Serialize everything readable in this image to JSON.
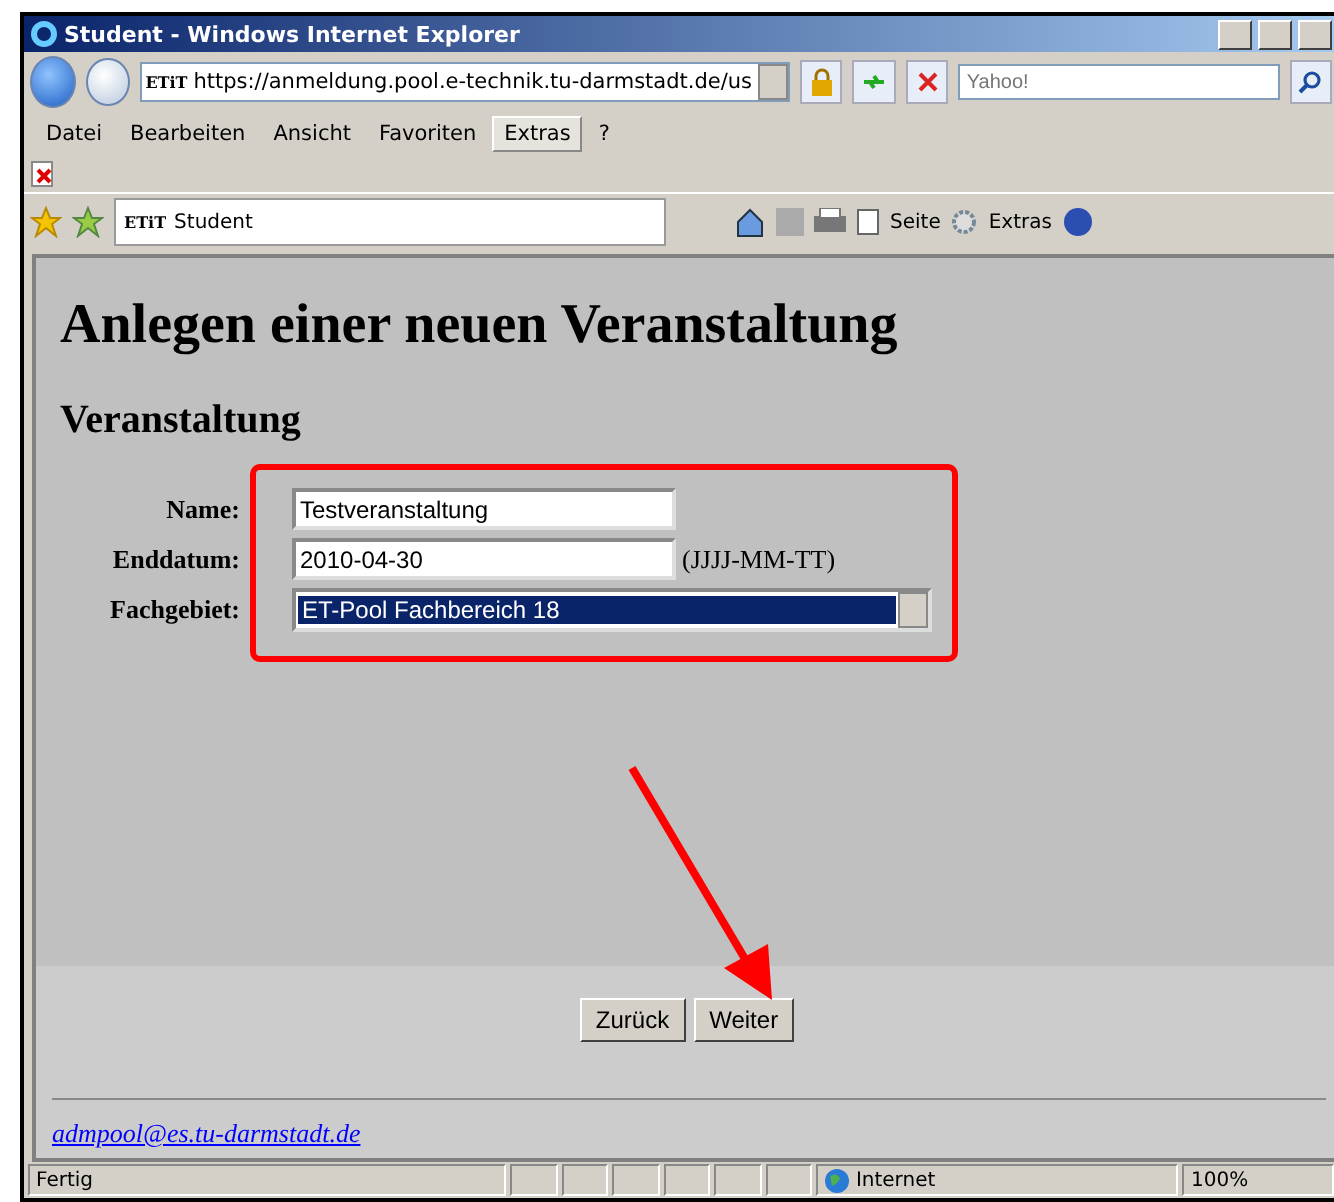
{
  "window": {
    "title": "Student - Windows Internet Explorer"
  },
  "address_bar": {
    "url": "https://anmeldung.pool.e-technik.tu-darmstadt.de/us",
    "site_badge": "ETiT"
  },
  "search": {
    "placeholder": "Yahoo!"
  },
  "menu": [
    {
      "label": "Datei",
      "selected": false
    },
    {
      "label": "Bearbeiten",
      "selected": false
    },
    {
      "label": "Ansicht",
      "selected": false
    },
    {
      "label": "Favoriten",
      "selected": false
    },
    {
      "label": "Extras",
      "selected": true
    },
    {
      "label": "?",
      "selected": false
    }
  ],
  "tab": {
    "badge": "ETiT",
    "label": "Student"
  },
  "command_bar": [
    {
      "label": "Seite"
    },
    {
      "label": "Extras"
    }
  ],
  "page": {
    "heading": "Anlegen einer neuen Veranstaltung",
    "subheading": "Veranstaltung",
    "fields": [
      {
        "kind": "text",
        "label": "Name:",
        "value": "Testveranstaltung"
      },
      {
        "kind": "text",
        "label": "Enddatum:",
        "value": "2010-04-30",
        "hint": "(JJJJ-MM-TT)"
      },
      {
        "kind": "select",
        "label": "Fachgebiet:",
        "value": "ET-Pool Fachbereich 18"
      }
    ],
    "buttons": [
      "Zurück",
      "Weiter"
    ],
    "footer_link": "admpool@es.tu-darmstadt.de"
  },
  "status_bar": {
    "text": "Fertig",
    "zone": "Internet",
    "zoom": "100%"
  }
}
